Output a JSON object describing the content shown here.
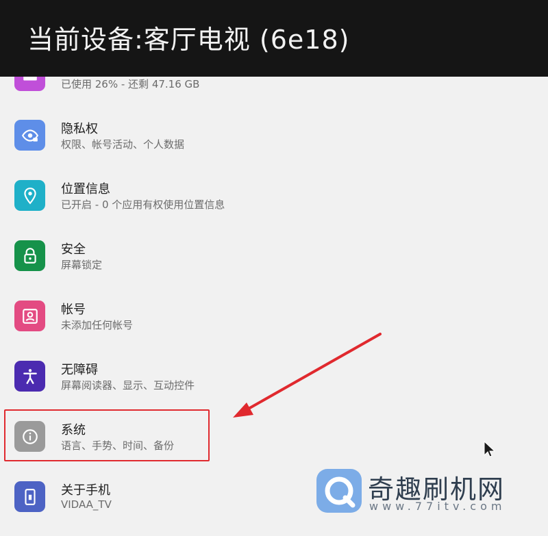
{
  "header": {
    "title": "当前设备:客厅电视 (6e18)"
  },
  "list": {
    "items": [
      {
        "title": "",
        "subtitle": "已使用 26% - 还剩 47.16 GB",
        "icon": "storage-icon",
        "color": "#c04fd9"
      },
      {
        "title": "隐私权",
        "subtitle": "权限、帐号活动、个人数据",
        "icon": "privacy-eye-icon",
        "color": "#5e8ee8"
      },
      {
        "title": "位置信息",
        "subtitle": "已开启 - 0 个应用有权使用位置信息",
        "icon": "location-pin-icon",
        "color": "#1fb0c8"
      },
      {
        "title": "安全",
        "subtitle": "屏幕锁定",
        "icon": "lock-icon",
        "color": "#16924a"
      },
      {
        "title": "帐号",
        "subtitle": "未添加任何帐号",
        "icon": "account-icon",
        "color": "#e34b82"
      },
      {
        "title": "无障碍",
        "subtitle": "屏幕阅读器、显示、互动控件",
        "icon": "accessibility-icon",
        "color": "#4b2bb0"
      },
      {
        "title": "系统",
        "subtitle": "语言、手势、时间、备份",
        "icon": "info-icon",
        "color": "#9a9a9a"
      },
      {
        "title": "关于手机",
        "subtitle": "VIDAA_TV",
        "icon": "phone-icon",
        "color": "#4d63c4"
      }
    ]
  },
  "annotation": {
    "highlight_color": "#e0292e"
  },
  "watermark": {
    "brand": "奇趣刷机网",
    "url": "www.77itv.com"
  }
}
